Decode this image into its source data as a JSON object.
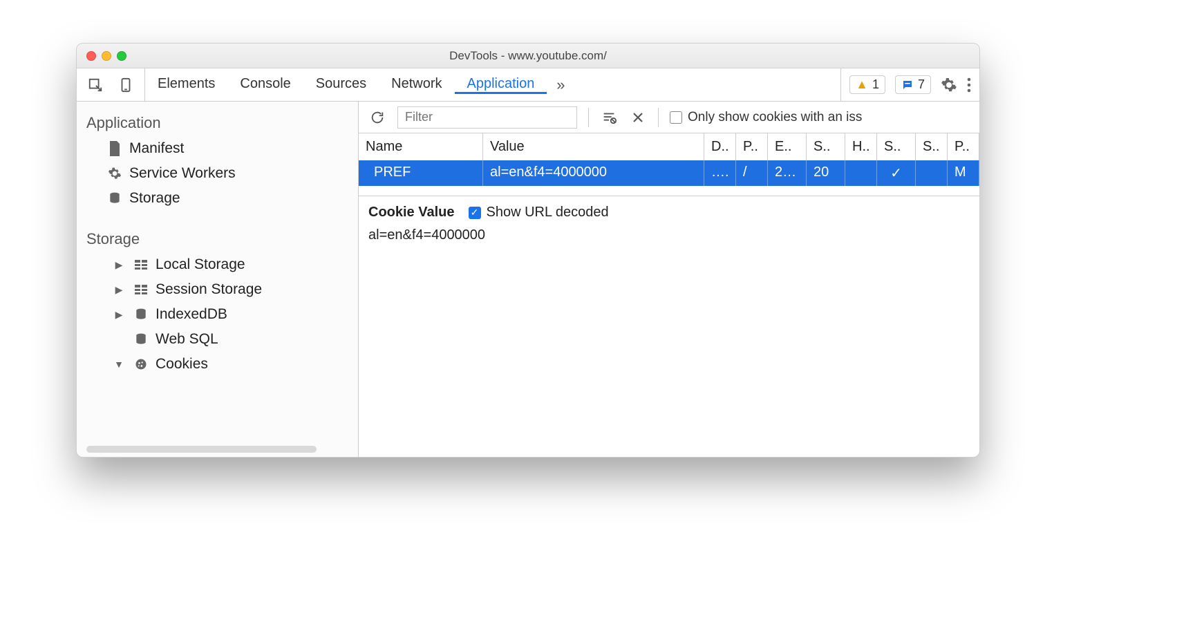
{
  "window": {
    "title": "DevTools - www.youtube.com/"
  },
  "tabs": {
    "items": [
      "Elements",
      "Console",
      "Sources",
      "Network",
      "Application"
    ],
    "active": "Application",
    "more": "»"
  },
  "warnings": {
    "count": "1"
  },
  "messages": {
    "count": "7"
  },
  "sidebar": {
    "groups": [
      {
        "title": "Application",
        "items": [
          {
            "label": "Manifest",
            "icon": "file"
          },
          {
            "label": "Service Workers",
            "icon": "gear"
          },
          {
            "label": "Storage",
            "icon": "database"
          }
        ]
      },
      {
        "title": "Storage",
        "items": [
          {
            "label": "Local Storage",
            "icon": "grid",
            "expandable": true,
            "expanded": false
          },
          {
            "label": "Session Storage",
            "icon": "grid",
            "expandable": true,
            "expanded": false
          },
          {
            "label": "IndexedDB",
            "icon": "database",
            "expandable": true,
            "expanded": false
          },
          {
            "label": "Web SQL",
            "icon": "database"
          },
          {
            "label": "Cookies",
            "icon": "cookie",
            "expandable": true,
            "expanded": true
          }
        ]
      }
    ]
  },
  "filterbar": {
    "placeholder": "Filter",
    "only_issues_label": "Only show cookies with an iss"
  },
  "cookies": {
    "columns": [
      "Name",
      "Value",
      "D..",
      "P..",
      "E..",
      "S..",
      "H..",
      "S..",
      "S..",
      "P.."
    ],
    "rows": [
      {
        "name": "PREF",
        "value": "al=en&f4=4000000",
        "domain": "….",
        "path": "/",
        "expires": "2…",
        "size": "20",
        "httponly": "",
        "secure": "✓",
        "samesite": "",
        "priority": "M"
      }
    ]
  },
  "detail": {
    "title": "Cookie Value",
    "decode_label": "Show URL decoded",
    "decode_checked": true,
    "value": "al=en&f4=4000000"
  }
}
